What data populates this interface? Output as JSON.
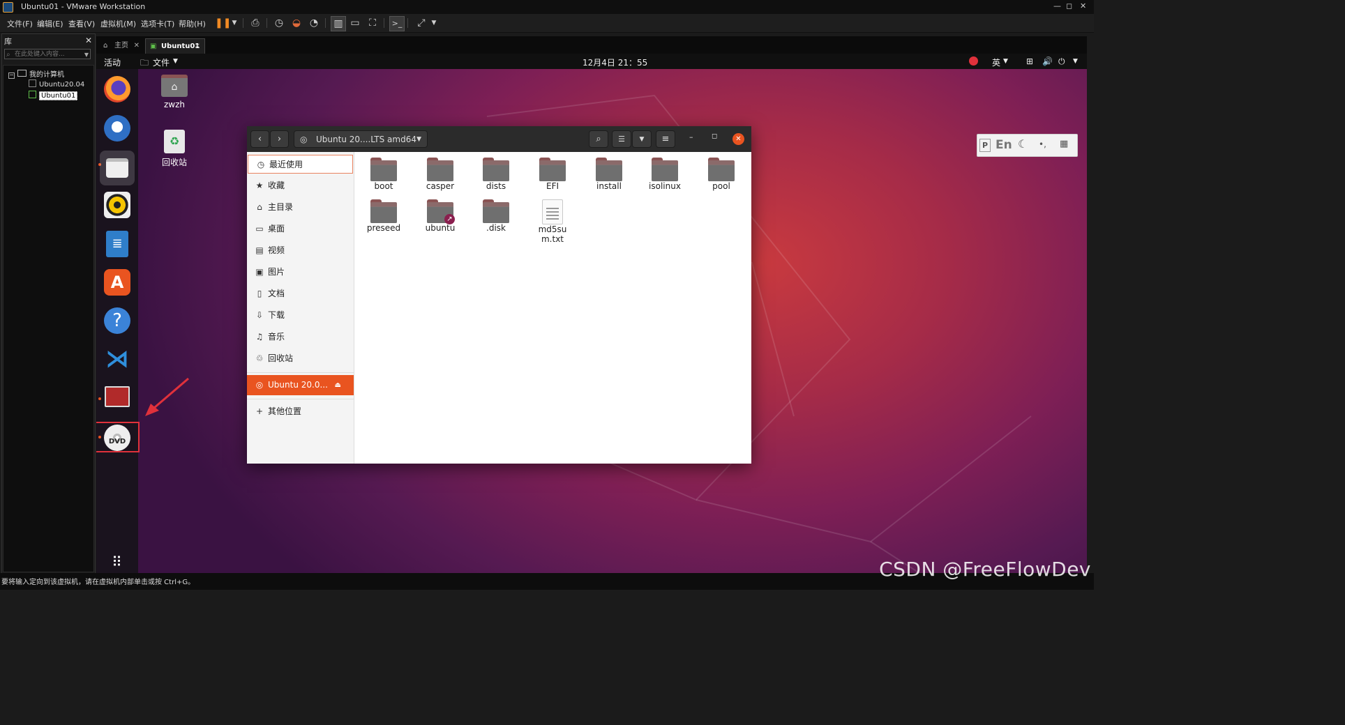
{
  "window": {
    "title": "Ubuntu01 - VMware Workstation"
  },
  "menu": [
    "文件(F)",
    "编辑(E)",
    "查看(V)",
    "虚拟机(M)",
    "选项卡(T)",
    "帮助(H)"
  ],
  "library": {
    "title": "库",
    "search_placeholder": "在此处键入内容...",
    "tree": {
      "root": "我的计算机",
      "items": [
        "Ubuntu20.04",
        "Ubuntu01"
      ]
    }
  },
  "tabs": [
    {
      "label": "主页"
    },
    {
      "label": "Ubuntu01"
    }
  ],
  "ubuntu": {
    "activities": "活动",
    "app_menu": "文件",
    "clock": "12月4日 21：55",
    "input_method": "英",
    "desktop_icons": [
      "zwzh",
      "回收站"
    ]
  },
  "nautilus": {
    "location": "Ubuntu 20....LTS amd64",
    "sidebar": [
      "最近使用",
      "收藏",
      "主目录",
      "桌面",
      "视频",
      "图片",
      "文档",
      "下载",
      "音乐",
      "回收站"
    ],
    "mounted": "Ubuntu 20.0...",
    "other": "其他位置",
    "files": [
      "boot",
      "casper",
      "dists",
      "EFI",
      "install",
      "isolinux",
      "pool",
      "preseed",
      "ubuntu",
      ".disk",
      "md5sum.txt"
    ]
  },
  "ime": {
    "label": "En"
  },
  "status": "要将输入定向到该虚拟机，请在虚拟机内部单击或按 Ctrl+G。",
  "watermark": "CSDN @FreeFlowDev",
  "colors": {
    "accent": "#e95420",
    "highlight": "#e0313b"
  }
}
